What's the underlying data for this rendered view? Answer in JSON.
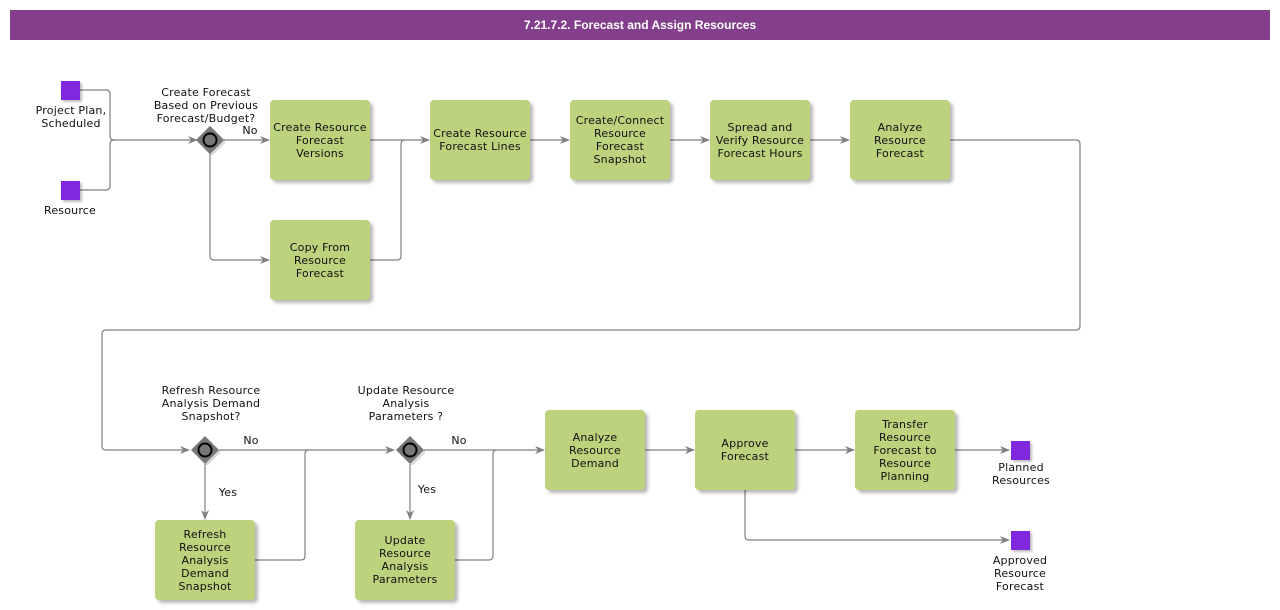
{
  "header": {
    "title": "7.21.7.2. Forecast and Assign Resources"
  },
  "colors": {
    "header": "#843f8c",
    "task": "#bdd27c",
    "data_object": "#8028e0",
    "gateway": "#777777",
    "connector": "#808080"
  },
  "data_objects": {
    "project_plan": "Project Plan,\nScheduled",
    "resource": "Resource",
    "planned_resources": "Planned\nResources",
    "approved_forecast": "Approved\nResource\nForecast"
  },
  "gateways": {
    "create_forecast": {
      "question": "Create Forecast\nBased on Previous\nForecast/Budget?",
      "no_label": "No"
    },
    "refresh_snapshot": {
      "question": "Refresh Resource\nAnalysis Demand\nSnapshot?",
      "no_label": "No",
      "yes_label": "Yes"
    },
    "update_params": {
      "question": "Update Resource\nAnalysis\nParameters ?",
      "no_label": "No",
      "yes_label": "Yes"
    }
  },
  "tasks": {
    "create_versions": "Create Resource\nForecast\nVersions",
    "copy_from": "Copy From\nResource\nForecast",
    "create_lines": "Create Resource\nForecast Lines",
    "create_snapshot": "Create/Connect\nResource\nForecast\nSnapshot",
    "spread_verify": "Spread and\nVerify Resource\nForecast Hours",
    "analyze_forecast": "Analyze\nResource\nForecast",
    "refresh_snapshot": "Refresh\nResource\nAnalysis\nDemand\nSnapshot",
    "update_params": "Update\nResource\nAnalysis\nParameters",
    "analyze_demand": "Analyze\nResource\nDemand",
    "approve": "Approve\nForecast",
    "transfer": "Transfer\nResource\nForecast to\nResource\nPlanning"
  }
}
